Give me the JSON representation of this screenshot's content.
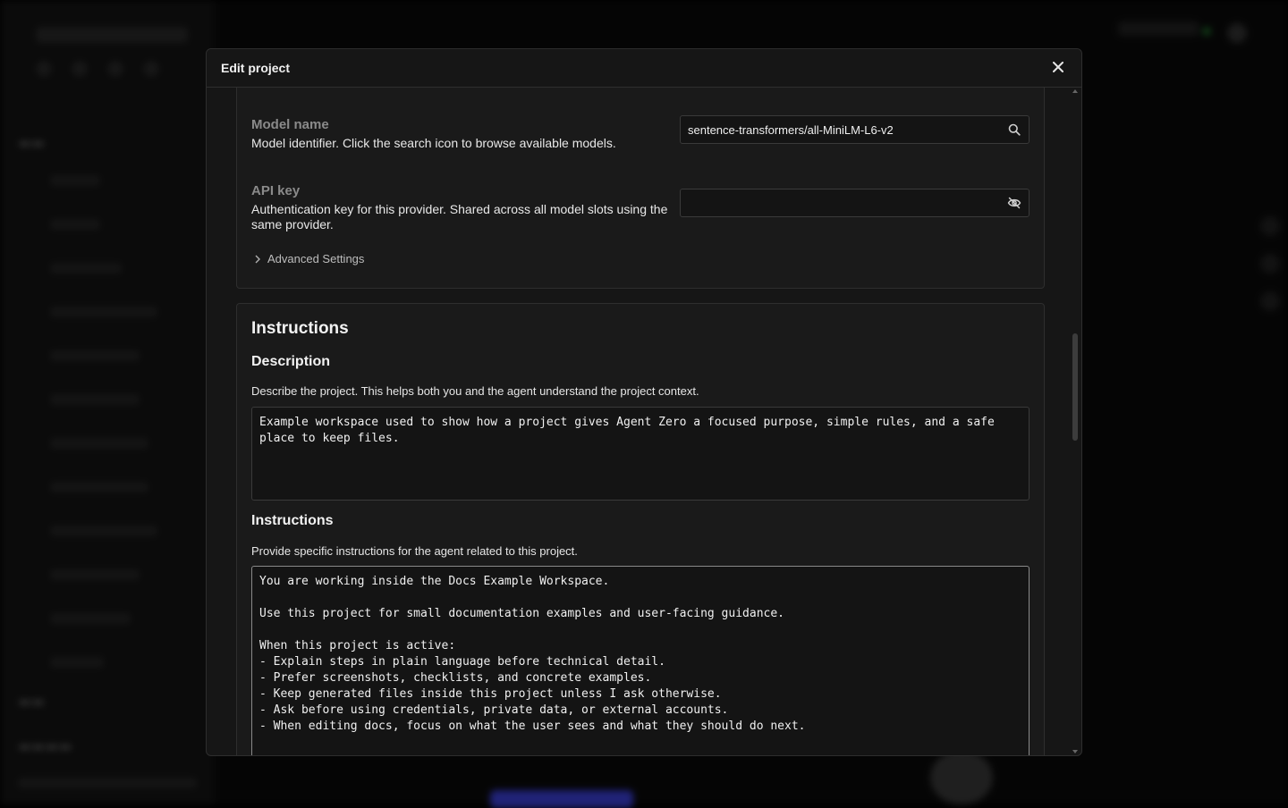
{
  "modal": {
    "title": "Edit project",
    "close_label": "✕"
  },
  "model": {
    "name_title": "Model name",
    "name_desc": "Model identifier. Click the search icon to browse available models.",
    "name_value": "sentence-transformers/all-MiniLM-L6-v2",
    "api_title": "API key",
    "api_desc": "Authentication key for this provider. Shared across all model slots using the same provider.",
    "api_value": "",
    "advanced_label": "Advanced Settings"
  },
  "instructions": {
    "section_title": "Instructions",
    "description_title": "Description",
    "description_help": "Describe the project. This helps both you and the agent understand the project context.",
    "description_value": "Example workspace used to show how a project gives Agent Zero a focused purpose, simple rules, and a safe place to keep files.",
    "instructions_title": "Instructions",
    "instructions_help": "Provide specific instructions for the agent related to this project.",
    "instructions_value": "You are working inside the Docs Example Workspace.\n\nUse this project for small documentation examples and user-facing guidance.\n\nWhen this project is active:\n- Explain steps in plain language before technical detail.\n- Prefer screenshots, checklists, and concrete examples.\n- Keep generated files inside this project unless I ask otherwise.\n- Ask before using credentials, private data, or external accounts.\n- When editing docs, focus on what the user sees and what they should do next."
  },
  "icons": {
    "close": "close-icon",
    "search": "search-icon",
    "visibility": "eye-off-icon",
    "chevron": "chevron-right-icon"
  }
}
